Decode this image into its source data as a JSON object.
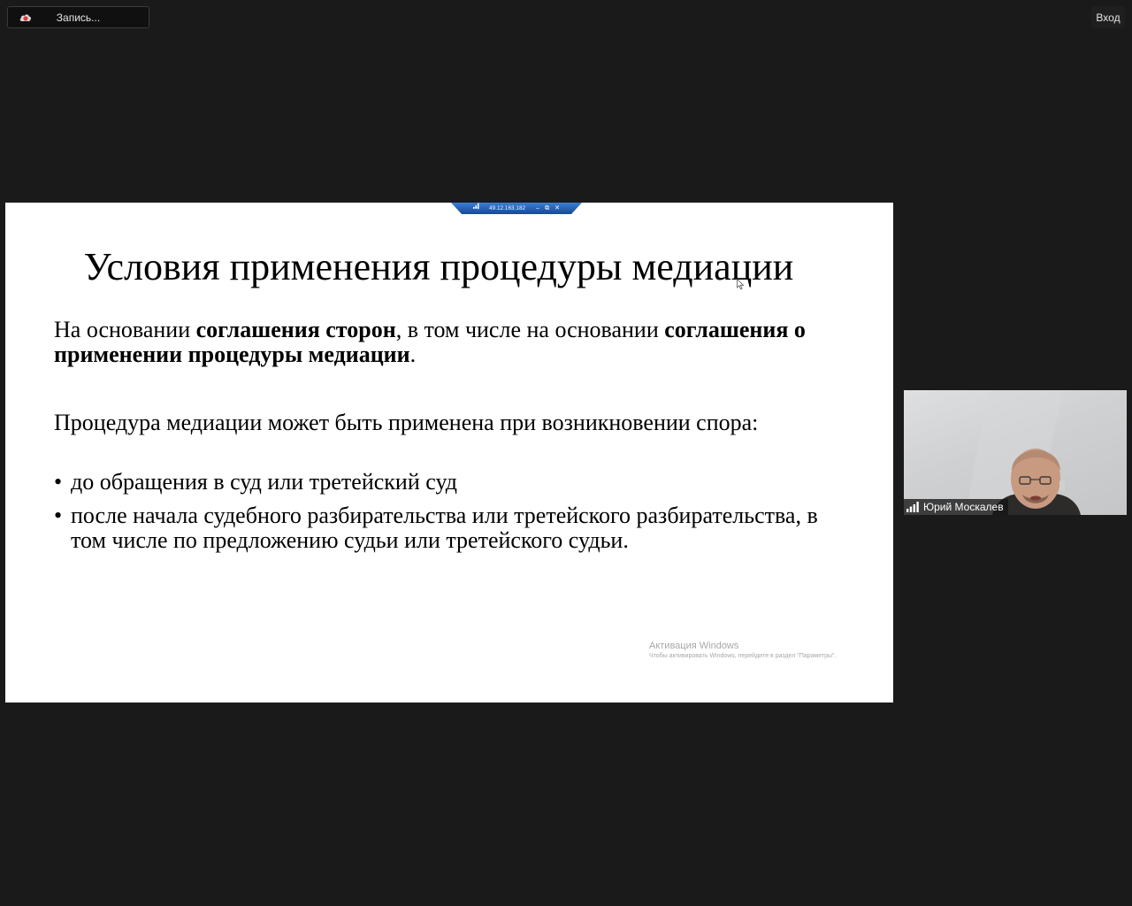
{
  "top_bar": {
    "recording_label": "Запись...",
    "login_label": "Вход"
  },
  "remote_toolbar": {
    "address": "49.12.163.182"
  },
  "slide": {
    "title": "Условия применения процедуры медиации",
    "p1_a": "На основании ",
    "p1_b": "соглашения сторон",
    "p1_c": ", в том числе на основании ",
    "p1_d": "соглашения о применении процедуры медиации",
    "p1_e": ".",
    "p2": "Процедура медиации может быть применена при возникновении спора:",
    "bullets": [
      "до обращения в суд или третейский суд",
      "после начала судебного разбирательства или третейского разбирательства, в том числе по предложению судьи или третейского судьи."
    ],
    "bullet_char": "•"
  },
  "watermark": {
    "title": "Активация Windows",
    "subtitle": "Чтобы активировать Windows, перейдите в раздел \"Параметры\"."
  },
  "participant": {
    "name": "Юрий Москалев"
  },
  "colors": {
    "background": "#1a1a1a",
    "rd_toolbar": "#1f5fb0",
    "record_red": "#e23a3a"
  }
}
